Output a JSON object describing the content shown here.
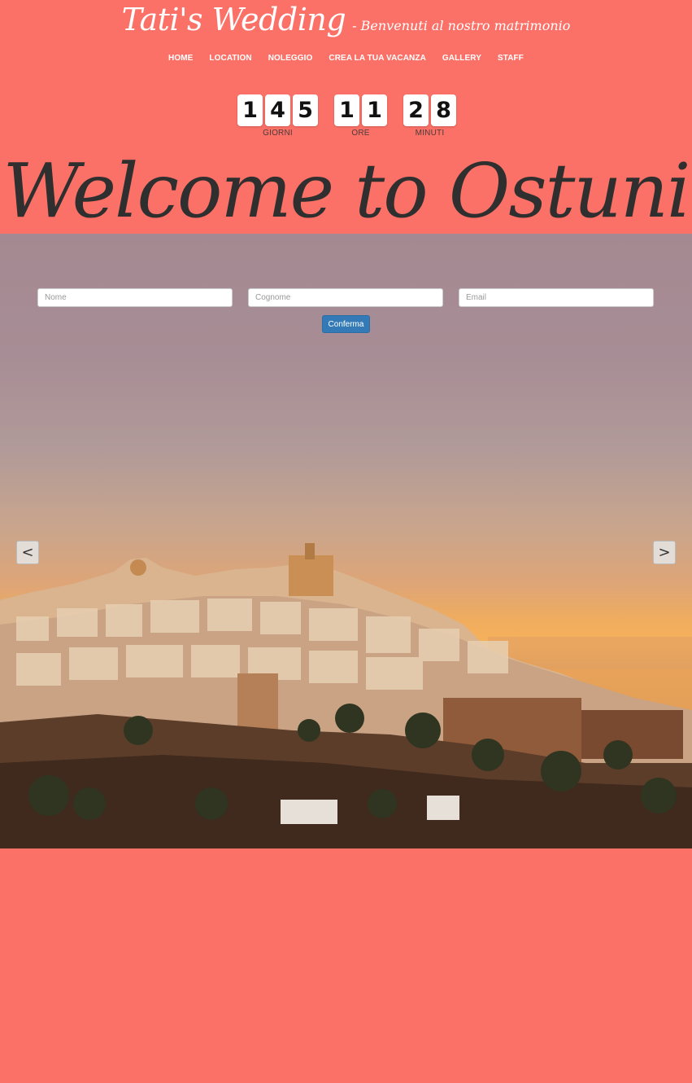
{
  "header": {
    "brand": "Tati's Wedding",
    "tagline": "- Benvenuti al nostro matrimonio"
  },
  "nav": {
    "items": [
      {
        "label": "HOME"
      },
      {
        "label": "LOCATION"
      },
      {
        "label": "NOLEGGIO"
      },
      {
        "label": "CREA LA TUA VACANZA"
      },
      {
        "label": "GALLERY"
      },
      {
        "label": "STAFF"
      }
    ]
  },
  "countdown": {
    "days": {
      "digits": [
        "1",
        "4",
        "5"
      ],
      "label": "GIORNI"
    },
    "hours": {
      "digits": [
        "1",
        "1"
      ],
      "label": "ORE"
    },
    "minutes": {
      "digits": [
        "2",
        "8"
      ],
      "label": "MINUTI"
    }
  },
  "hero": {
    "title": "Welcome to Ostuni"
  },
  "form": {
    "nome_placeholder": "Nome",
    "cognome_placeholder": "Cognome",
    "email_placeholder": "Email",
    "submit_label": "Conferma"
  },
  "carousel": {
    "prev_label": "<",
    "next_label": ">"
  },
  "colors": {
    "background": "#fc7167",
    "submit": "#337ab7"
  }
}
